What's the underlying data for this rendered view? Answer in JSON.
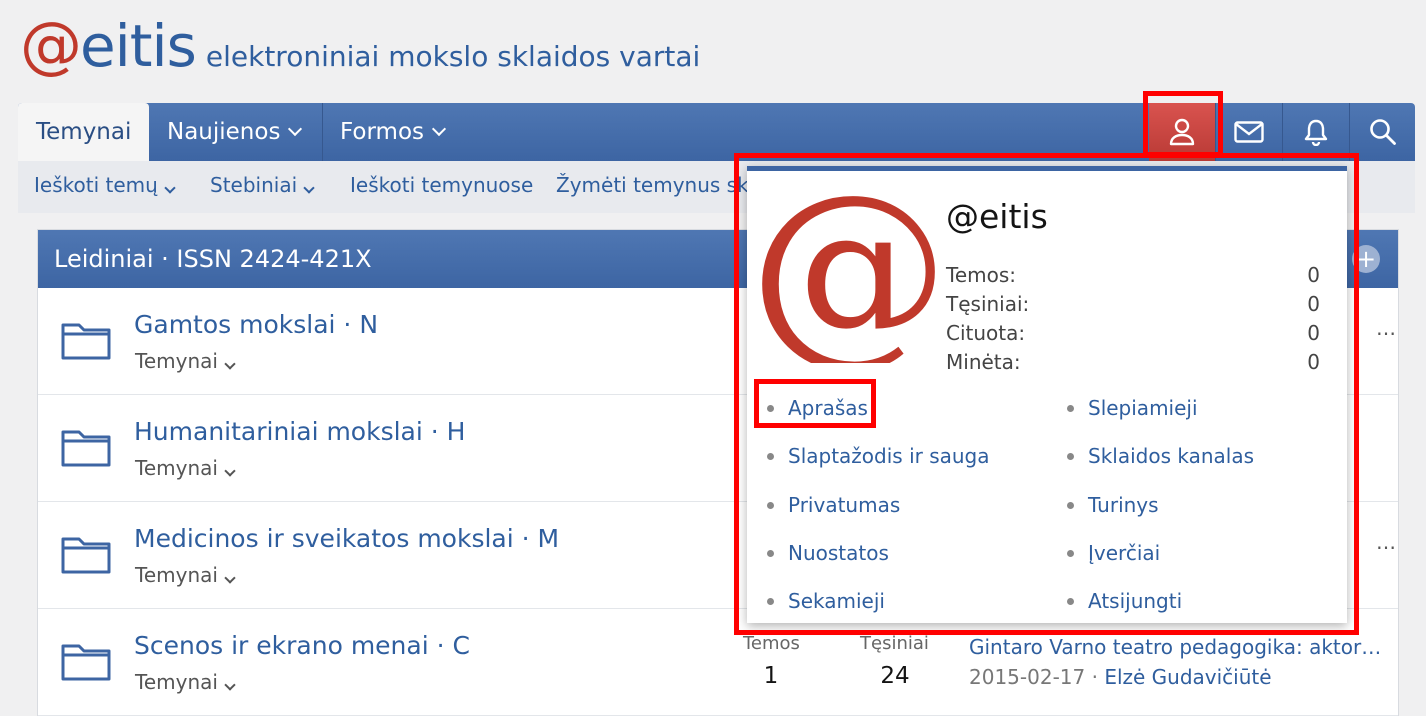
{
  "brand": {
    "at": "@",
    "name": "eitis",
    "tagline": "elektroniniai mokslo sklaidos vartai"
  },
  "nav": {
    "tabs": [
      "Temynai",
      "Naujienos",
      "Formos"
    ],
    "icons": [
      "user-icon",
      "mail-icon",
      "bell-icon",
      "search-icon"
    ]
  },
  "subnav": [
    "Ieškoti temų",
    "Stebiniai",
    "Ieškoti temynuose",
    "Žymėti temynus skaitytais"
  ],
  "block": {
    "title": "Leidiniai · ISSN 2424-421X"
  },
  "rows": [
    {
      "title": "Gamtos mokslai · N",
      "sub": "Temynai"
    },
    {
      "title": "Humanitariniai mokslai · H",
      "sub": "Temynai"
    },
    {
      "title": "Medicinos ir sveikatos mokslai · M",
      "sub": "Temynai"
    },
    {
      "title": "Scenos ir ekrano menai · C",
      "sub": "Temynai"
    }
  ],
  "last_row": {
    "themes_label": "Temos",
    "themes": "1",
    "cont_label": "Tęsiniai",
    "cont": "24",
    "last_title": "Gintaro Varno teatro pedagogika: aktor…",
    "last_date": "2015-02-17",
    "last_author": "Elzė Gudavičiūtė"
  },
  "popup": {
    "name": "@eitis",
    "avatar_glyph": "@",
    "stats": [
      {
        "label": "Temos:",
        "value": "0"
      },
      {
        "label": "Tęsiniai:",
        "value": "0"
      },
      {
        "label": "Cituota:",
        "value": "0"
      },
      {
        "label": "Minėta:",
        "value": "0"
      }
    ],
    "links_left": [
      "Aprašas",
      "Slaptažodis ir sauga",
      "Privatumas",
      "Nuostatos",
      "Sekamieji"
    ],
    "links_right": [
      "Slepiamieji",
      "Sklaidos kanalas",
      "Turinys",
      "Įverčiai",
      "Atsijungti"
    ]
  },
  "colors": {
    "accent": "#3d65a3",
    "brand_red": "#c0392b",
    "highlight": "#ff0000"
  }
}
